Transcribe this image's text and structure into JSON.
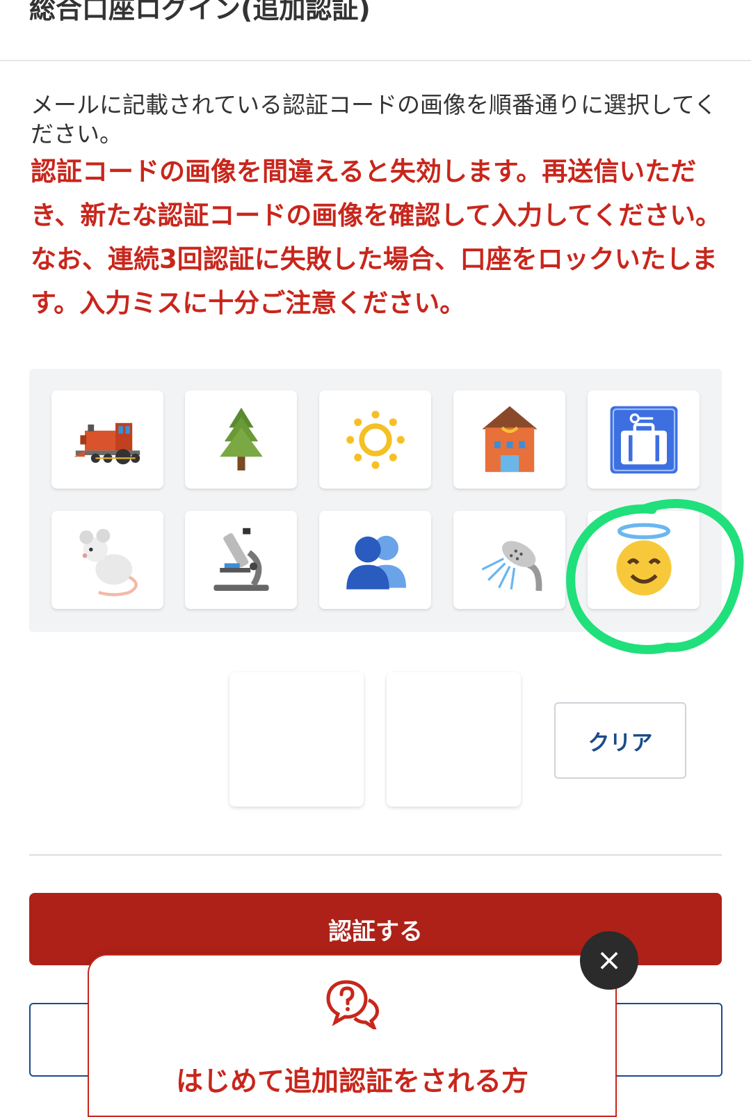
{
  "header": {
    "title": "総合口座ログイン(追加認証)"
  },
  "instruction": "メールに記載されている認証コードの画像を順番通りに選択してください。",
  "warning": {
    "line1": "認証コードの画像を間違えると失効します。再送信いただき、新たな認証コードの画像を確認して入力してください。",
    "line2": "なお、連続3回認証に失敗した場合、口座をロックいたします。入力ミスに十分ご注意ください。"
  },
  "icons": [
    "steam-locomotive-icon",
    "evergreen-tree-icon",
    "sun-icon",
    "post-office-icon",
    "baggage-claim-icon",
    "mouse-icon",
    "microscope-icon",
    "busts-in-silhouette-icon",
    "shower-icon",
    "smiling-face-with-halo-icon"
  ],
  "clear_button": {
    "label": "クリア"
  },
  "submit_button": {
    "label": "認証する"
  },
  "help_popup": {
    "text": "はじめて追加認証をされる方",
    "close_glyph": "×"
  },
  "colors": {
    "accent_red": "#ad2118",
    "warning_red": "#c8261c",
    "link_blue": "#1a4c8b",
    "annotation_green": "#1fe07a"
  }
}
